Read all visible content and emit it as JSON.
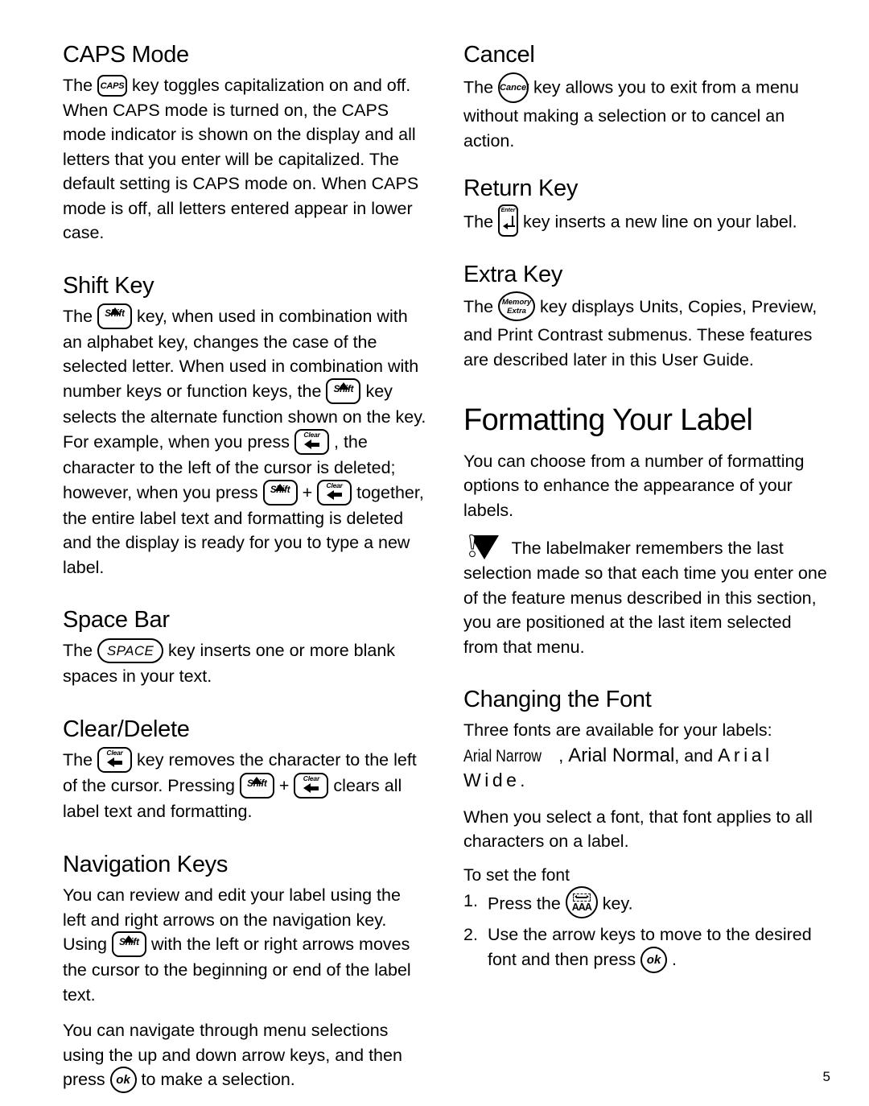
{
  "page": {
    "number": "5"
  },
  "left_column": {
    "sections": [
      {
        "heading": "CAPS Mode",
        "body_pre": "The",
        "key": "caps-key",
        "key_label": "CAPS",
        "body_post": "key toggles capitalization on and off. When CAPS mode is turned on, the CAPS mode indicator is shown on the display and all letters that you enter will be capitalized. The default setting is CAPS mode on. When CAPS mode is off, all letters entered appear in lower case."
      },
      {
        "heading": "Shift Key",
        "p1_a": "The",
        "p1_b": "key, when used in combination with an alphabet key, changes the case of the selected letter. When used in combination with number keys or function keys, the",
        "p1_c": "key selects the alternate function shown on the key. For example, when you press",
        "p1_d": ", the character to the left of the cursor is deleted; however, when you press",
        "p1_e": "+",
        "p1_f": "together, the entire label text and formatting is deleted and the display is ready for you to type a new label."
      },
      {
        "heading": "Space Bar",
        "p1_a": "The",
        "space_label": "SPACE",
        "p1_b": "key inserts one or more blank spaces in your text."
      },
      {
        "heading": "Clear/Delete",
        "p1_a": "The",
        "p1_b": "key removes the character to the left of the cursor. Pressing",
        "p1_c": "+",
        "p1_d": "clears all label text and formatting."
      },
      {
        "heading": "Navigation Keys",
        "p1_a": "You can review and edit your label using the left and right arrows on the navigation key. Using",
        "p1_b": "with the left or right arrows moves the cursor to the beginning or end of the label text.",
        "p2_a": "You can navigate through menu selections using the up and down arrow keys, and then press",
        "ok_label": "ok",
        "p2_b": "to make a selection."
      }
    ],
    "shift_key_label": "Shift",
    "clear_key_label": "Clear"
  },
  "right_column": {
    "cancel": {
      "heading": "Cancel",
      "p_a": "The",
      "key_label": "Cancel",
      "p_b": "key allows you to exit from a menu without making a selection or to cancel an action."
    },
    "return_key": {
      "heading": "Return Key",
      "p_a": "The",
      "key_label": "Enter",
      "p_b": "key inserts a new line on your label."
    },
    "extra_key": {
      "heading": "Extra Key",
      "p_a": "The",
      "key_label_line1": "Memory",
      "key_label_line2": "Extra",
      "p_b": "key displays Units, Copies, Preview, and Print Contrast submenus. These features are described later in this User Guide."
    },
    "chapter": {
      "title": "Formatting Your Label",
      "intro": "You can choose from a number of formatting options to enhance the appearance of your labels.",
      "note": "The labelmaker remembers the last selection made so that each time you enter one of the feature menus described in this section, you are positioned at the last item selected from that menu."
    },
    "changing_font": {
      "heading": "Changing the Font",
      "p1_a": "Three fonts are available for your labels:",
      "font_narrow": "Arial Narrow",
      "p1_sep1": ",",
      "font_normal": "Arial Normal",
      "p1_sep2": ", and",
      "font_wide": "Arial Wide",
      "p1_end": ".",
      "p2": "When you select a font, that font applies to all characters on a label.",
      "subheading": "To set the font",
      "steps": [
        {
          "num": "1.",
          "a": "Press the",
          "key": "font-key",
          "b": "key."
        },
        {
          "num": "2.",
          "a": "Use the arrow keys to move to the desired font and then press",
          "key": "ok-key",
          "key_label": "ok",
          "b": "."
        }
      ],
      "font_key_label": "AAA"
    }
  }
}
